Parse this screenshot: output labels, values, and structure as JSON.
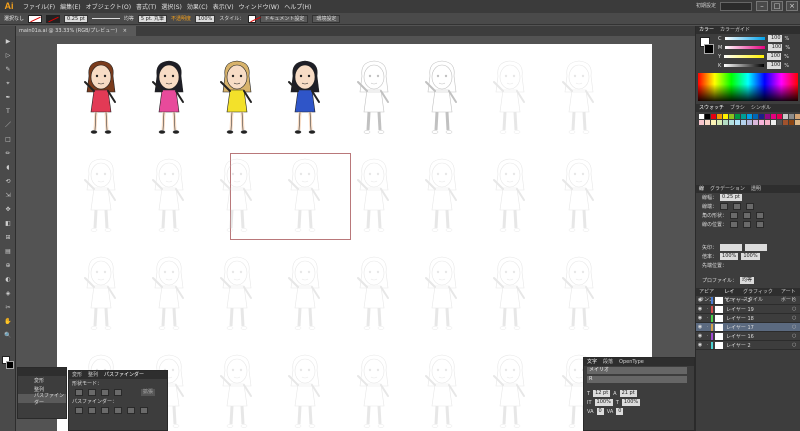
{
  "app": {
    "logo": "Ai",
    "workspace": "初期設定"
  },
  "menu": [
    "ファイル(F)",
    "編集(E)",
    "オブジェクト(O)",
    "書式(T)",
    "選択(S)",
    "効果(C)",
    "表示(V)",
    "ウィンドウ(W)",
    "ヘルプ(H)"
  ],
  "window_buttons": [
    "–",
    "□",
    "×"
  ],
  "control": {
    "selection": "選択なし",
    "stroke_weight": "0.25 pt",
    "stroke_style": "均等",
    "brush": "5 pt. 丸筆",
    "opacity_label": "不透明度",
    "opacity_value": "100%",
    "style_label": "スタイル：",
    "doc_setup": "ドキュメント設定",
    "prefs": "環境設定"
  },
  "doc_tab": {
    "title": "main01a.ai @ 33.33% (RGB/プレビュー)",
    "close": "×"
  },
  "tools": [
    "▶",
    "▷",
    "✎",
    "⌖",
    "✒",
    "T",
    "／",
    "□",
    "✏",
    "◖",
    "⟲",
    "⇲",
    "✥",
    "◧",
    "⊞",
    "▤",
    "⊕",
    "◐",
    "◈",
    "✂",
    "✋",
    "🔍"
  ],
  "color_panel": {
    "tabs": [
      "カラー",
      "カラーガイド"
    ],
    "rows": [
      {
        "label": "C",
        "value": "100",
        "unit": "%"
      },
      {
        "label": "M",
        "value": "100",
        "unit": "%"
      },
      {
        "label": "Y",
        "value": "100",
        "unit": "%"
      },
      {
        "label": "K",
        "value": "100",
        "unit": "%"
      }
    ]
  },
  "swatch_panel": {
    "tabs": [
      "スウォッチ",
      "ブラシ",
      "シンボル"
    ],
    "colors": [
      "#ffffff",
      "#000000",
      "#e60012",
      "#f39800",
      "#fff100",
      "#8fc31f",
      "#009944",
      "#009e96",
      "#00a0e9",
      "#0068b7",
      "#1d2088",
      "#920783",
      "#e4007f",
      "#e5004f",
      "#c8c8c8",
      "#8c8c8c",
      "#d4a373",
      "#f7c5cc",
      "#fadbc8",
      "#fcf3b5",
      "#d9ecb5",
      "#b3dcc3",
      "#b3dfe0",
      "#b3e3f9",
      "#b3d1ec",
      "#b6b9dd",
      "#d9b6d9",
      "#f7b3d9",
      "#f7b3c9",
      "#eeeeee",
      "#555555",
      "#a0522d",
      "#8b4513",
      "#deb887"
    ]
  },
  "stroke_panel": {
    "tabs": [
      "線",
      "グラデーション",
      "透明"
    ],
    "weight_label": "線幅：",
    "weight_value": "0.25 pt",
    "cap_label": "線端：",
    "corner_label": "角の形状：",
    "align_label": "線の位置：",
    "arrow_label": "矢印：",
    "scale_label": "倍率：",
    "scale_a": "100%",
    "scale_b": "100%",
    "align2_label": "先端位置：",
    "profile_label": "プロファイル：",
    "profile_value": "均等"
  },
  "layers_panel": {
    "tabs": [
      "アピアランス",
      "レイヤー",
      "グラフィックスタイル",
      "アートボード"
    ],
    "layers": [
      {
        "name": "レイヤー 2",
        "color": "#4a7bd0",
        "selected": false
      },
      {
        "name": "レイヤー 19",
        "color": "#d04a4a",
        "selected": false
      },
      {
        "name": "レイヤー 18",
        "color": "#4ad04a",
        "selected": false
      },
      {
        "name": "レイヤー 17",
        "color": "#d0a04a",
        "selected": true
      },
      {
        "name": "レイヤー 16",
        "color": "#a04ad0",
        "selected": false
      },
      {
        "name": "レイヤー 2",
        "color": "#4ad0d0",
        "selected": false
      }
    ]
  },
  "font_panel": {
    "tabs": [
      "文字",
      "段落",
      "OpenType"
    ],
    "font_family": "メイリオ",
    "font_style": "R",
    "size": "12 pt",
    "leading": "21 pt",
    "hscale": "100%",
    "vscale": "100%",
    "tracking": "0",
    "kerning": "0"
  },
  "links_panel": {
    "items": [
      "変形",
      "整列",
      "パスファインダー"
    ]
  },
  "pathfinder_panel": {
    "tabs": [
      "変形",
      "整列",
      "パスファインダー"
    ],
    "shape_mode_label": "形状モード：",
    "expand": "拡張",
    "pathfinder_label": "パスファインダー："
  },
  "artboard": {
    "colored_characters": [
      {
        "hair": "#7a3b1c",
        "dress": "#e23a55"
      },
      {
        "hair": "#1e1e26",
        "dress": "#e84a9b"
      },
      {
        "hair": "#d8b36b",
        "dress": "#f3e12a"
      },
      {
        "hair": "#1e1e26",
        "dress": "#2f55c8"
      }
    ]
  }
}
